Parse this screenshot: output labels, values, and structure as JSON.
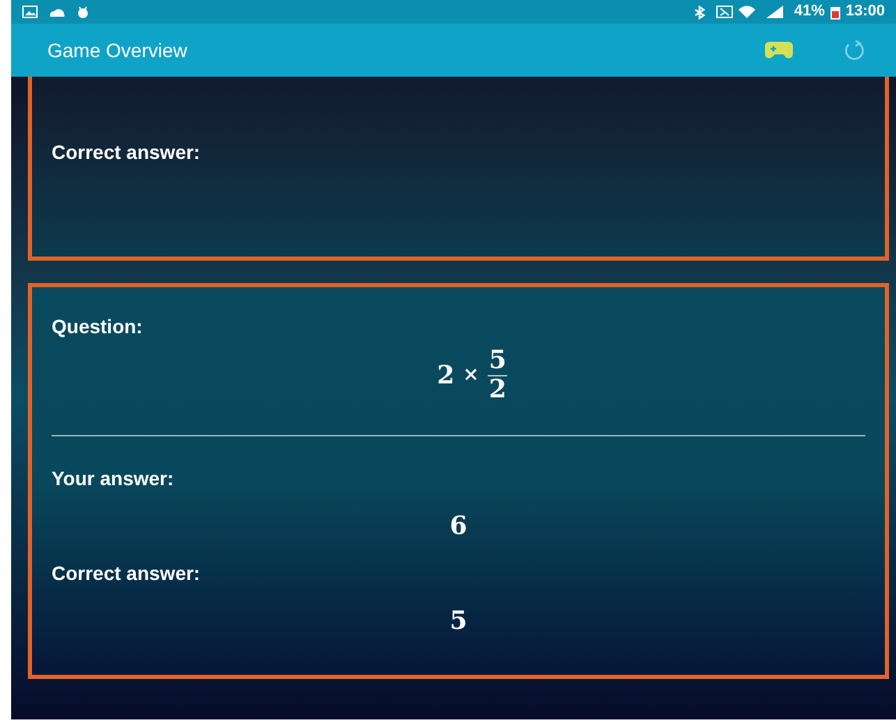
{
  "status_bar": {
    "battery": "41%",
    "time": "13:00"
  },
  "app_bar": {
    "title": "Game Overview"
  },
  "cards": [
    {
      "cut_top": true,
      "items": [
        {
          "kind": "label",
          "text": "Correct answer:"
        }
      ]
    },
    {
      "cut_top": false,
      "items": [
        {
          "kind": "label",
          "text": "Question:"
        },
        {
          "kind": "fraction",
          "whole": "2",
          "operator": "×",
          "numerator": "5",
          "denominator": "2"
        },
        {
          "kind": "divider"
        },
        {
          "kind": "label",
          "text": "Your answer:"
        },
        {
          "kind": "value",
          "text": "6"
        },
        {
          "kind": "label",
          "text": "Correct answer:"
        },
        {
          "kind": "value",
          "text": "5"
        }
      ]
    }
  ]
}
